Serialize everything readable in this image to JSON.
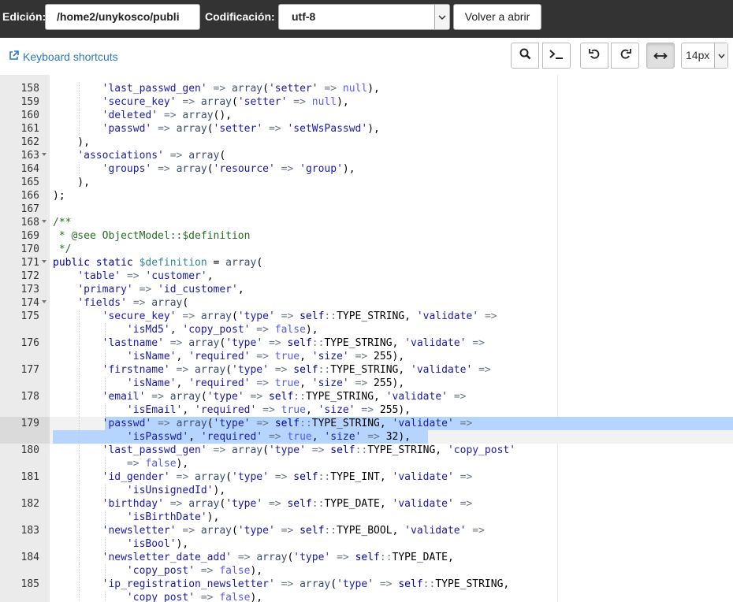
{
  "toolbar_top": {
    "edit_label": "Edición:",
    "path_value": "/home2/unykosco/publi",
    "encoding_label": "Codificación:",
    "encoding_value": "utf-8",
    "reopen_label": "Volver a abrir"
  },
  "toolbar": {
    "keyboard_shortcuts": "Keyboard shortcuts",
    "font_size": "14px",
    "buttons": [
      "search-icon",
      "terminal-icon",
      "undo-icon",
      "redo-icon",
      "wrap-icon"
    ]
  },
  "editor": {
    "active_line": "179",
    "lines": [
      {
        "row": 1,
        "num": "158",
        "code": "        'last_passwd_gen' => array('setter' => null),"
      },
      {
        "row": 2,
        "num": "159",
        "code": "        'secure_key' => array('setter' => null),"
      },
      {
        "row": 3,
        "num": "160",
        "code": "        'deleted' => array(),"
      },
      {
        "row": 4,
        "num": "161",
        "code": "        'passwd' => array('setter' => 'setWsPasswd'),"
      },
      {
        "row": 5,
        "num": "162",
        "code": "    ),"
      },
      {
        "row": 6,
        "num": "163",
        "fold": true,
        "code": "    'associations' => array("
      },
      {
        "row": 7,
        "num": "164",
        "code": "        'groups' => array('resource' => 'group'),"
      },
      {
        "row": 8,
        "num": "165",
        "code": "    ),"
      },
      {
        "row": 9,
        "num": "166",
        "code": ");"
      },
      {
        "row": 10,
        "num": "167",
        "code": ""
      },
      {
        "row": 11,
        "num": "168",
        "fold": true,
        "code": "/**"
      },
      {
        "row": 12,
        "num": "169",
        "code": " * @see ObjectModel::$definition"
      },
      {
        "row": 13,
        "num": "170",
        "code": " */"
      },
      {
        "row": 14,
        "num": "171",
        "fold": true,
        "code": "public static $definition = array("
      },
      {
        "row": 15,
        "num": "172",
        "code": "    'table' => 'customer',"
      },
      {
        "row": 16,
        "num": "173",
        "code": "    'primary' => 'id_customer',"
      },
      {
        "row": 17,
        "num": "174",
        "fold": true,
        "code": "    'fields' => array("
      },
      {
        "row": 18,
        "num": "175",
        "code": "        'secure_key' => array('type' => self::TYPE_STRING, 'validate' =>"
      },
      {
        "row": 19,
        "num": "",
        "code": "            'isMd5', 'copy_post' => false),"
      },
      {
        "row": 20,
        "num": "176",
        "code": "        'lastname' => array('type' => self::TYPE_STRING, 'validate' =>"
      },
      {
        "row": 21,
        "num": "",
        "code": "            'isName', 'required' => true, 'size' => 255),"
      },
      {
        "row": 22,
        "num": "177",
        "code": "        'firstname' => array('type' => self::TYPE_STRING, 'validate' =>"
      },
      {
        "row": 23,
        "num": "",
        "code": "            'isName', 'required' => true, 'size' => 255),"
      },
      {
        "row": 24,
        "num": "178",
        "code": "        'email' => array('type' => self::TYPE_STRING, 'validate' =>"
      },
      {
        "row": 25,
        "num": "",
        "code": "            'isEmail', 'required' => true, 'size' => 255),"
      },
      {
        "row": 26,
        "num": "179",
        "active": true,
        "code": "        'passwd' => array('type' => self::TYPE_STRING, 'validate' =>"
      },
      {
        "row": 27,
        "num": "",
        "active": true,
        "code": "            'isPasswd', 'required' => true, 'size' => 32),"
      },
      {
        "row": 28,
        "num": "180",
        "code": "        'last_passwd_gen' => array('type' => self::TYPE_STRING, 'copy_post'"
      },
      {
        "row": 29,
        "num": "",
        "code": "            => false),"
      },
      {
        "row": 30,
        "num": "181",
        "code": "        'id_gender' => array('type' => self::TYPE_INT, 'validate' =>"
      },
      {
        "row": 31,
        "num": "",
        "code": "            'isUnsignedId'),"
      },
      {
        "row": 32,
        "num": "182",
        "code": "        'birthday' => array('type' => self::TYPE_DATE, 'validate' =>"
      },
      {
        "row": 33,
        "num": "",
        "code": "            'isBirthDate'),"
      },
      {
        "row": 34,
        "num": "183",
        "code": "        'newsletter' => array('type' => self::TYPE_BOOL, 'validate' =>"
      },
      {
        "row": 35,
        "num": "",
        "code": "            'isBool'),"
      },
      {
        "row": 36,
        "num": "184",
        "code": "        'newsletter_date_add' => array('type' => self::TYPE_DATE,"
      },
      {
        "row": 37,
        "num": "",
        "code": "            'copy_post' => false),"
      },
      {
        "row": 38,
        "num": "185",
        "code": "        'ip_registration_newsletter' => array('type' => self::TYPE_STRING,"
      },
      {
        "row": 39,
        "num": "",
        "code": "            'copy_post' => false),"
      }
    ]
  }
}
